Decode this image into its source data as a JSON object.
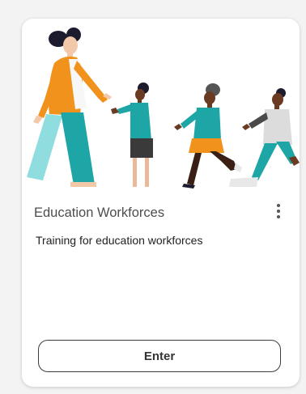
{
  "card": {
    "title": "Education Workforces",
    "description": "Training for education workforces",
    "enter_label": "Enter",
    "menu_icon": "more-vertical-icon",
    "illustration": "people-reaching-out-illustration"
  },
  "colors": {
    "orange": "#f0921b",
    "teal": "#1ea5a6",
    "light_teal": "#8fdddf",
    "skin": "#f2c8a8",
    "dark_skin": "#6b3a23",
    "hair": "#1c1c2e",
    "gray_top": "#dcdcdc"
  }
}
